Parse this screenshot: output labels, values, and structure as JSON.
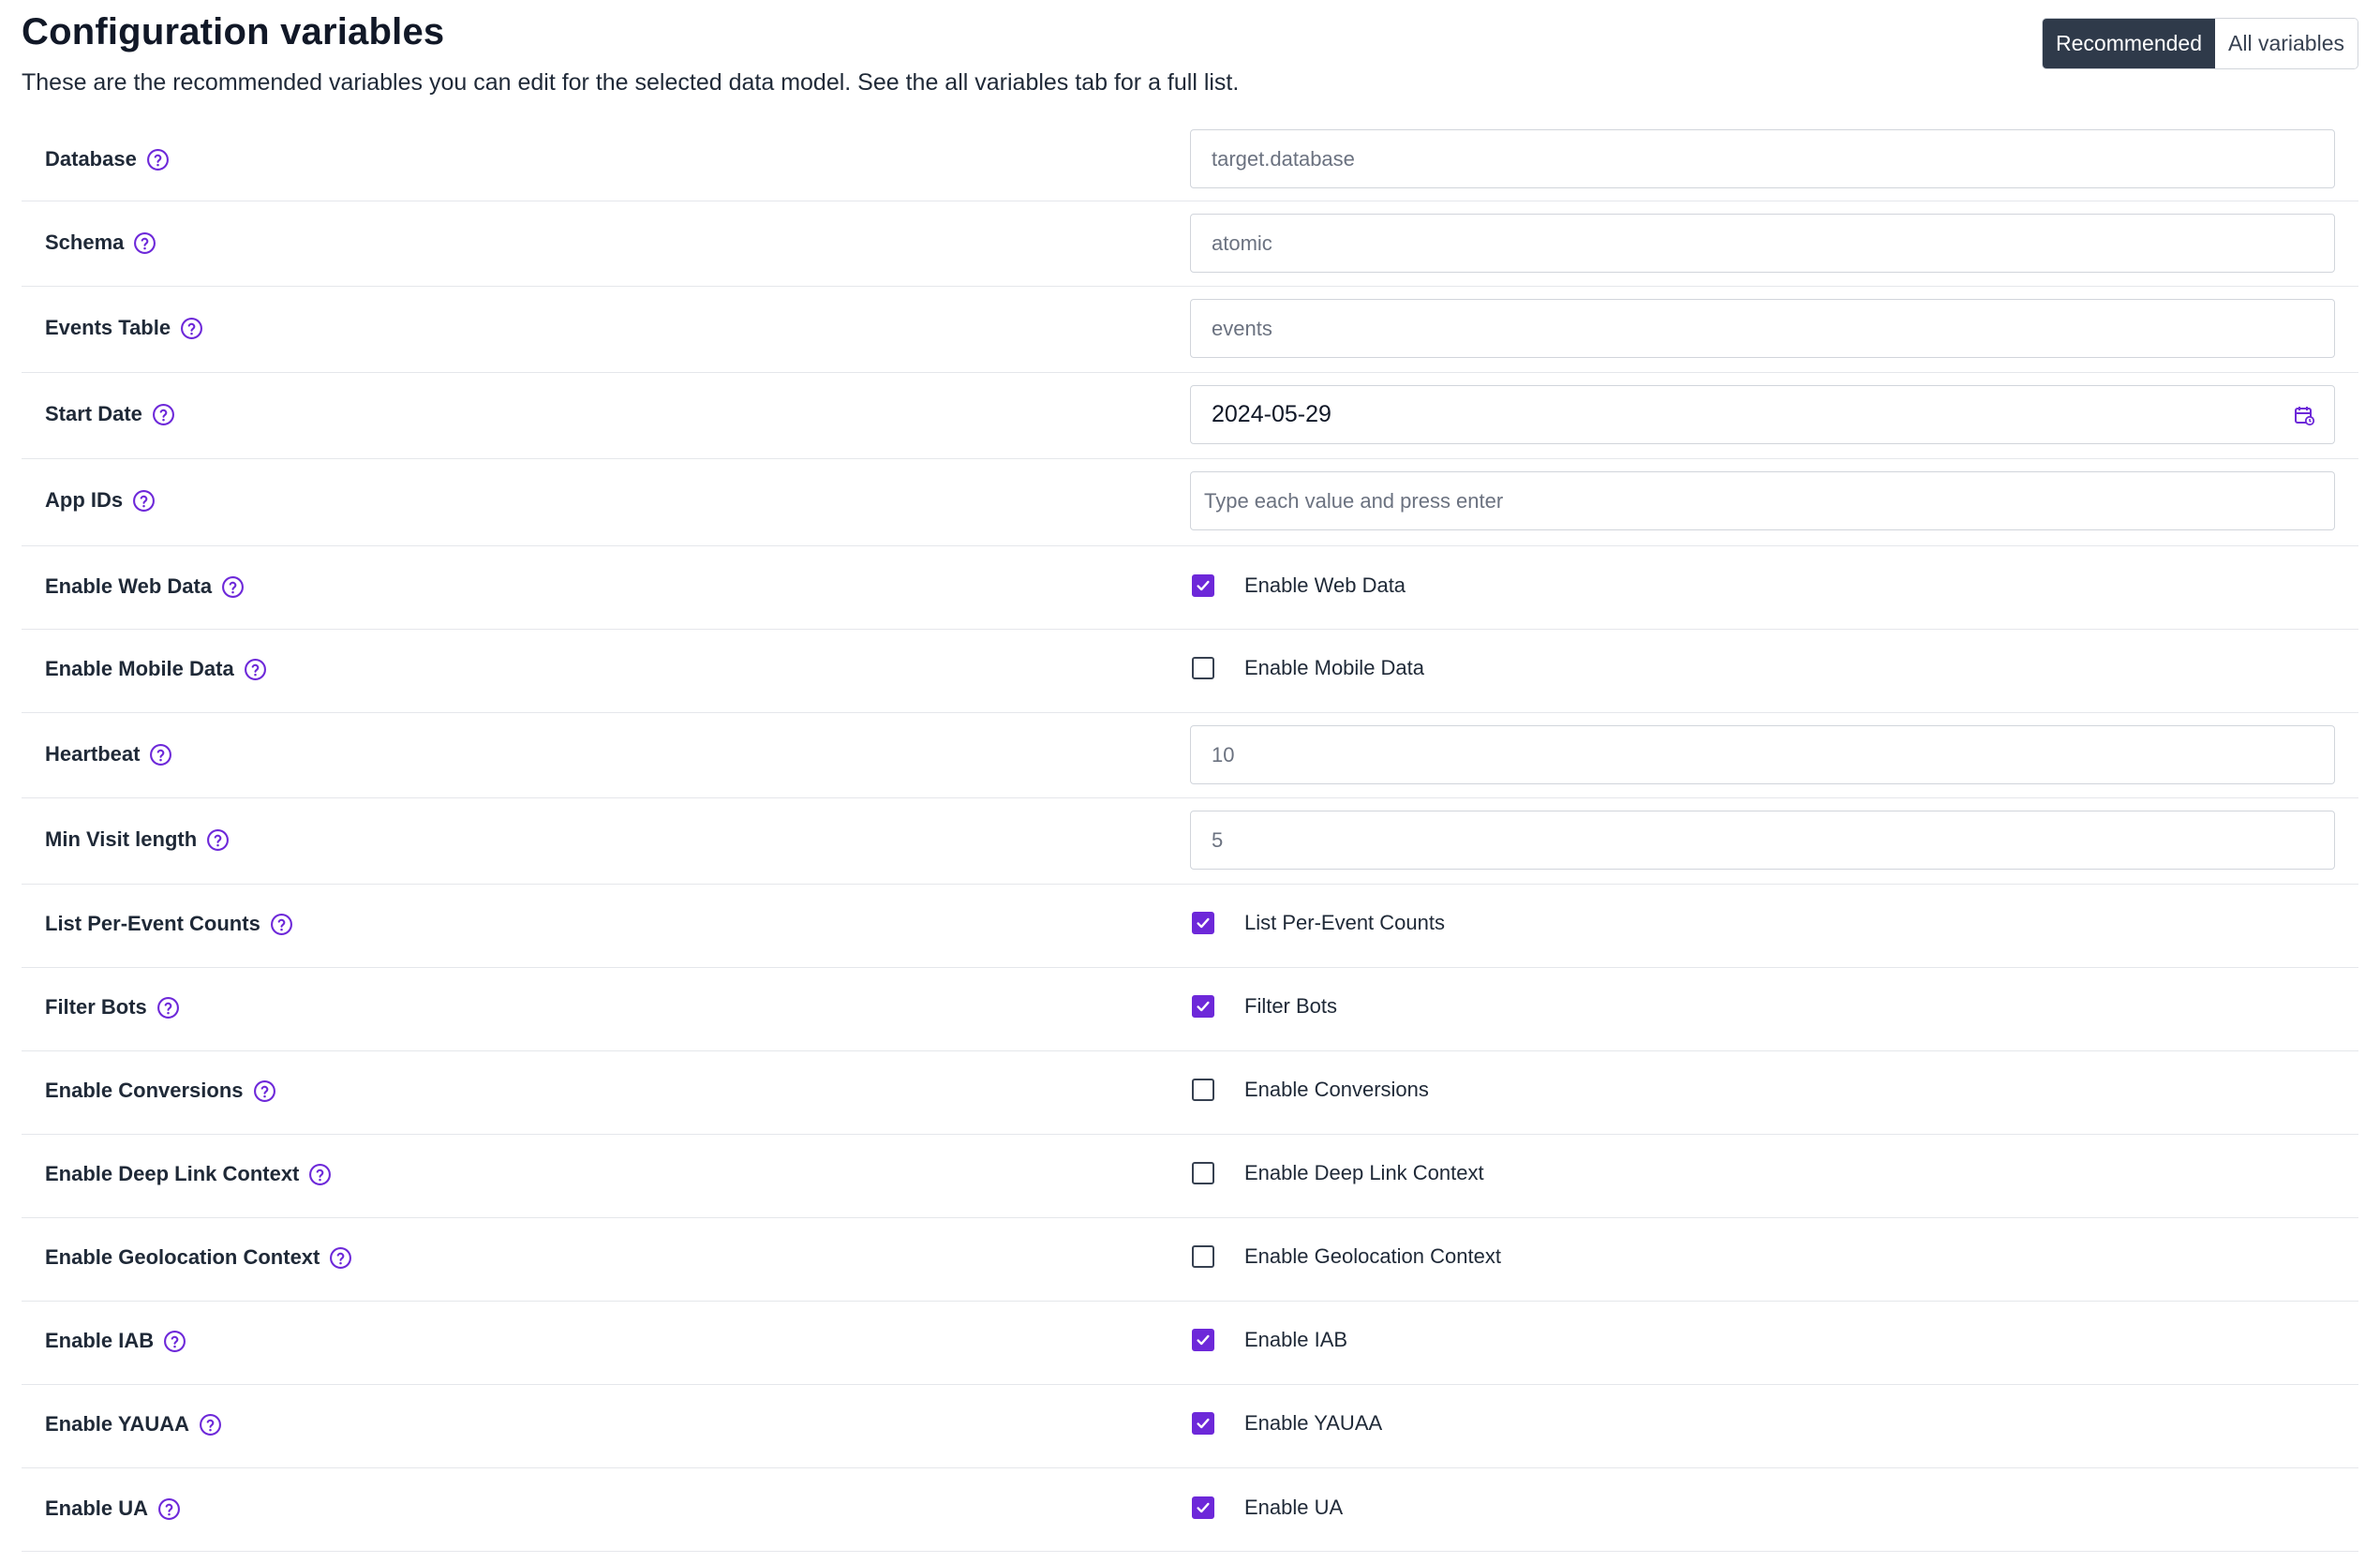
{
  "header": {
    "title": "Configuration variables",
    "subtitle": "These are the recommended variables you can edit for the selected data model. See the all variables tab for a full list.",
    "tabs": [
      {
        "label": "Recommended",
        "active": true
      },
      {
        "label": "All variables",
        "active": false
      }
    ]
  },
  "colors": {
    "accent": "#6d28d9",
    "toggle_active_bg": "#2f3a4a"
  },
  "fields": {
    "database": {
      "label": "Database",
      "placeholder": "target.database"
    },
    "schema": {
      "label": "Schema",
      "placeholder": "atomic"
    },
    "events_table": {
      "label": "Events Table",
      "placeholder": "events"
    },
    "start_date": {
      "label": "Start Date",
      "value": "2024-05-29",
      "icon": "calendar-icon"
    },
    "app_ids": {
      "label": "App IDs",
      "placeholder": "Type each value and press enter"
    },
    "enable_web_data": {
      "label": "Enable Web Data",
      "checkbox_label": "Enable Web Data",
      "checked": true
    },
    "enable_mobile_data": {
      "label": "Enable Mobile Data",
      "checkbox_label": "Enable Mobile Data",
      "checked": false
    },
    "heartbeat": {
      "label": "Heartbeat",
      "placeholder": "10"
    },
    "min_visit_length": {
      "label": "Min Visit length",
      "placeholder": "5"
    },
    "list_per_event_counts": {
      "label": "List Per-Event Counts",
      "checkbox_label": "List Per-Event Counts",
      "checked": true
    },
    "filter_bots": {
      "label": "Filter Bots",
      "checkbox_label": "Filter Bots",
      "checked": true
    },
    "enable_conversions": {
      "label": "Enable Conversions",
      "checkbox_label": "Enable Conversions",
      "checked": false
    },
    "enable_deep_link_context": {
      "label": "Enable Deep Link Context",
      "checkbox_label": "Enable Deep Link Context",
      "checked": false
    },
    "enable_geolocation_context": {
      "label": "Enable Geolocation Context",
      "checkbox_label": "Enable Geolocation Context",
      "checked": false
    },
    "enable_iab": {
      "label": "Enable IAB",
      "checkbox_label": "Enable IAB",
      "checked": true
    },
    "enable_yauaa": {
      "label": "Enable YAUAA",
      "checkbox_label": "Enable YAUAA",
      "checked": true
    },
    "enable_ua": {
      "label": "Enable UA",
      "checkbox_label": "Enable UA",
      "checked": true
    }
  },
  "help_icon": "question-circle-icon"
}
